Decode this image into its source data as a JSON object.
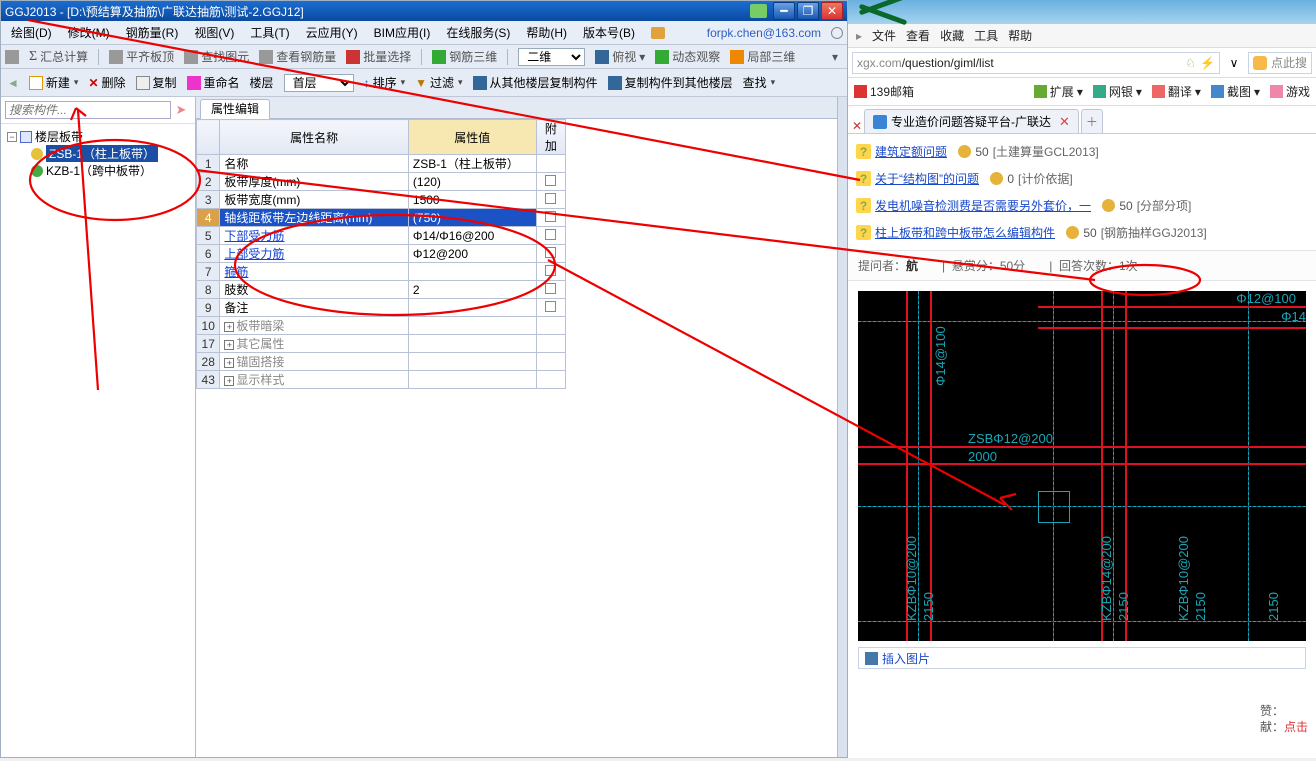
{
  "titlebar": {
    "app": "GGJ2013",
    "path": " - [D:\\预结算及抽筋\\广联达抽筋\\测试-2.GGJ12]"
  },
  "menu": {
    "draw": "绘图(D)",
    "edit": "修改(M)",
    "steel": "钢筋量(R)",
    "view": "视图(V)",
    "tool": "工具(T)",
    "cloud": "云应用(Y)",
    "bim": "BIM应用(I)",
    "online": "在线服务(S)",
    "help": "帮助(H)",
    "ver": "版本号(B)",
    "account": "forpk.chen@163.com"
  },
  "tb1": {
    "sum": "汇总计算",
    "lvl": "平齐板顶",
    "find": "查找图元",
    "qty": "查看钢筋量",
    "batch": "批量选择",
    "s3d": "钢筋三维",
    "d2": "二维",
    "side": "俯视",
    "dyn": "动态观察",
    "local": "局部三维"
  },
  "tb2": {
    "new": "新建",
    "del": "删除",
    "copy": "复制",
    "ren": "重命名",
    "floorlbl": "楼层",
    "floor": "首层",
    "sort": "排序",
    "filter": "过滤",
    "copyfrom": "从其他楼层复制构件",
    "copyto": "复制构件到其他楼层",
    "search": "查找"
  },
  "searchPlaceholder": "搜索构件...",
  "tree": {
    "root": "楼层板带",
    "n1": "ZSB-1（柱上板带）",
    "n2": "KZB-1（跨中板带）"
  },
  "tab": "属性编辑",
  "gridHeader": {
    "name": "属性名称",
    "val": "属性值",
    "add": "附加"
  },
  "rows": [
    {
      "no": "1",
      "name": "名称",
      "val": "ZSB-1（柱上板带）",
      "chk": false,
      "link": false
    },
    {
      "no": "2",
      "name": "板带厚度(mm)",
      "val": "(120)",
      "chk": true,
      "link": false
    },
    {
      "no": "3",
      "name": "板带宽度(mm)",
      "val": "1500",
      "chk": true,
      "link": false
    },
    {
      "no": "4",
      "name": "轴线距板带左边线距离(mm)",
      "val": "(750)",
      "chk": true,
      "link": false,
      "sel": true
    },
    {
      "no": "5",
      "name": "下部受力筋",
      "val": "Φ14/Φ16@200",
      "chk": true,
      "link": true
    },
    {
      "no": "6",
      "name": "上部受力筋",
      "val": "Φ12@200",
      "chk": true,
      "link": true
    },
    {
      "no": "7",
      "name": "箍筋",
      "val": "",
      "chk": true,
      "link": true
    },
    {
      "no": "8",
      "name": "肢数",
      "val": "2",
      "chk": true,
      "link": false
    },
    {
      "no": "9",
      "name": "备注",
      "val": "",
      "chk": true,
      "link": false
    },
    {
      "no": "10",
      "name": "板带暗梁",
      "val": "",
      "plus": true,
      "dis": true
    },
    {
      "no": "17",
      "name": "其它属性",
      "val": "",
      "plus": true,
      "dis": true
    },
    {
      "no": "28",
      "name": "锚固搭接",
      "val": "",
      "plus": true,
      "dis": true
    },
    {
      "no": "43",
      "name": "显示样式",
      "val": "",
      "plus": true,
      "dis": true
    }
  ],
  "brtop": {
    "file": "文件",
    "view": "查看",
    "fav": "收藏",
    "tool": "工具",
    "help": "帮助"
  },
  "url": {
    "gray": "xgx.com",
    "dark": "/question/giml/list"
  },
  "searchHint": "点此搜",
  "toolrow": {
    "mail": "139邮箱",
    "ext": "扩展",
    "bank": "网银",
    "trans": "翻译",
    "shot": "截图",
    "game": "游戏"
  },
  "btab": {
    "label": "专业造价问题答疑平台-广联达"
  },
  "qa": [
    {
      "title": "建筑定额问题",
      "pts": "50",
      "tag": "[土建算量GCL2013]"
    },
    {
      "title": "关于“结构图”的问题",
      "pts": "0",
      "tag": "[计价依据]"
    },
    {
      "title": "发电机噪音检测费是否需要另外套价，一",
      "pts": "50",
      "tag": "[分部分项]"
    },
    {
      "title": "柱上板带和跨中板带怎么编辑构件",
      "pts": "50",
      "tag": "[钢筋抽样GGJ2013]"
    }
  ],
  "meta": {
    "asker": "提问者：",
    "askerName": "航",
    "bounty": "悬赏分：50分",
    "answers": "回答次数：1次"
  },
  "drawing": {
    "zsb": "ZSBΦ12@200",
    "w": "2000",
    "t1": "Φ12@100",
    "t2": "Φ14",
    "k1": "KZBΦ10@200",
    "k2": "2150",
    "k3": "KZBΦ14@200",
    "k4": "2150",
    "k5": "KZBΦ10@200",
    "k6": "2150",
    "k7": "2150",
    "v1": "Φ14@100"
  },
  "insert": "插入图片",
  "footer": {
    "src": "赞：",
    "contrib": "献：",
    "click": "点击"
  }
}
